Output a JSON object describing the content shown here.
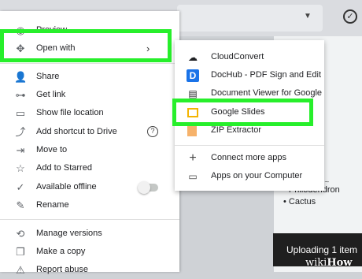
{
  "context_menu": {
    "items": [
      {
        "label": "Preview",
        "icon": "eye-icon"
      },
      {
        "label": "Open with",
        "icon": "move-arrows-icon"
      },
      {
        "label": "Share",
        "icon": "add-person-icon"
      },
      {
        "label": "Get link",
        "icon": "link-icon"
      },
      {
        "label": "Show file location",
        "icon": "folder-icon"
      },
      {
        "label": "Add shortcut to Drive",
        "icon": "shortcut-icon"
      },
      {
        "label": "Move to",
        "icon": "move-to-icon"
      },
      {
        "label": "Add to Starred",
        "icon": "star-icon"
      },
      {
        "label": "Available offline",
        "icon": "offline-check-icon"
      },
      {
        "label": "Rename",
        "icon": "pencil-icon"
      },
      {
        "label": "Manage versions",
        "icon": "history-icon"
      },
      {
        "label": "Make a copy",
        "icon": "copy-icon"
      },
      {
        "label": "Report abuse",
        "icon": "report-icon"
      }
    ],
    "open_with_chevron": "›",
    "help_glyph": "?",
    "available_offline_toggle_on": false
  },
  "open_with_submenu": {
    "items": [
      {
        "label": "CloudConvert",
        "icon": "cloud-icon"
      },
      {
        "label": "DocHub - PDF Sign and Edit",
        "icon": "dochub-icon",
        "icon_text": "D"
      },
      {
        "label": "Document Viewer for Google Drive",
        "icon": "document-viewer-icon"
      },
      {
        "label": "Google Slides",
        "icon": "google-slides-icon"
      },
      {
        "label": "ZIP Extractor",
        "icon": "zip-icon"
      },
      {
        "label": "Connect more apps",
        "icon": "plus-icon"
      },
      {
        "label": "Apps on your Computer",
        "icon": "laptop-icon"
      }
    ]
  },
  "background": {
    "list_items": [
      "Philodendron",
      "Cactus"
    ],
    "upload_status": "Uploading 1 item",
    "watermark": {
      "prefix": "wiki",
      "suffix": "How"
    }
  },
  "colors": {
    "highlight": "#27ef2b",
    "slides_yellow": "#f4b400",
    "dochub_blue": "#1a73e8"
  }
}
